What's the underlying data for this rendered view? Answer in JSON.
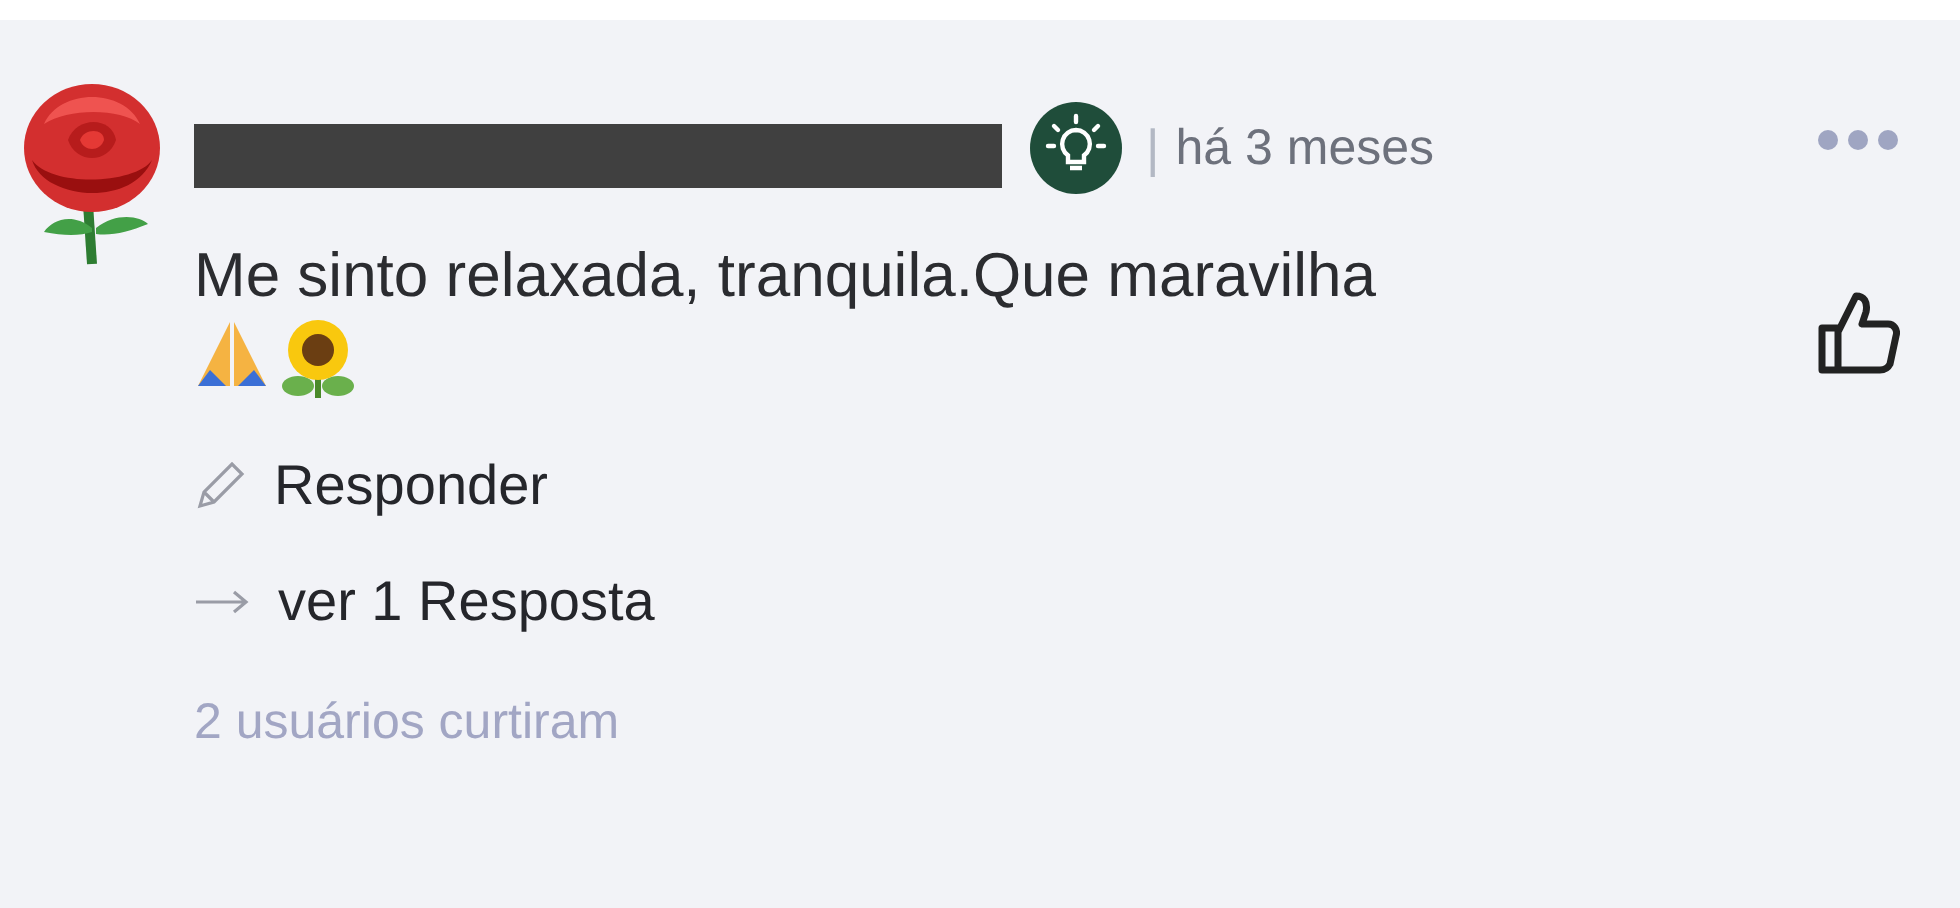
{
  "comment": {
    "author_redacted": true,
    "time": "há 3 meses",
    "separator": "|",
    "body": "Me sinto relaxada, tranquila.Que maravilha",
    "actions": [
      {
        "kind": "reply",
        "label": "Responder"
      },
      {
        "kind": "replies",
        "label": "ver 1 Resposta"
      }
    ],
    "likes": "2 usuários curtiram"
  }
}
